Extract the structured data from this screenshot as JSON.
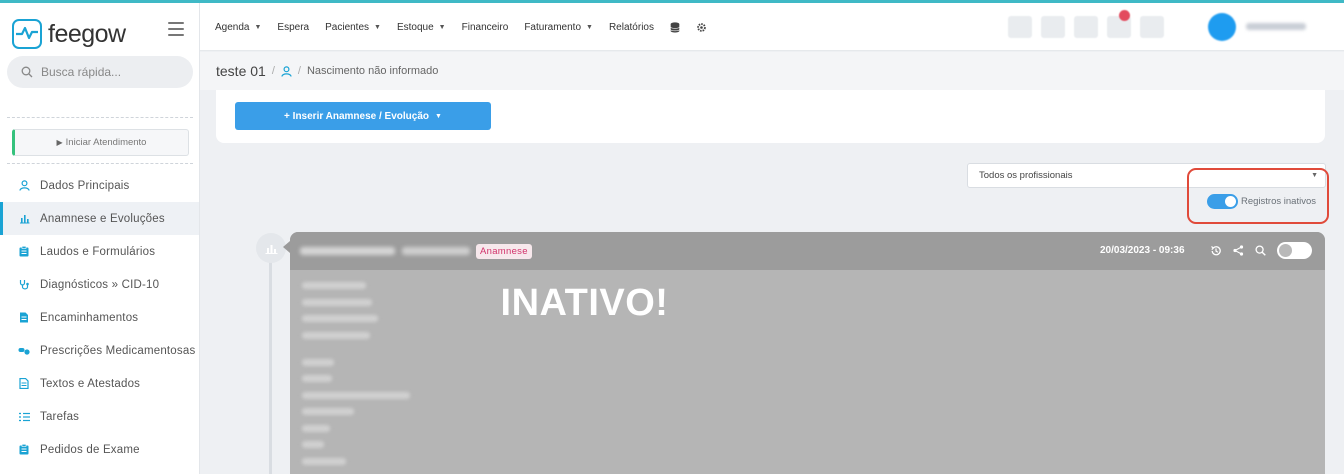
{
  "app": {
    "brand": "feegow"
  },
  "sidebar": {
    "search_placeholder": "Busca rápida...",
    "start_button": "Iniciar Atendimento",
    "items": [
      {
        "label": "Dados Principais",
        "icon": "user-icon"
      },
      {
        "label": "Anamnese e Evoluções",
        "icon": "chart-icon",
        "active": true
      },
      {
        "label": "Laudos e Formulários",
        "icon": "clipboard-icon"
      },
      {
        "label": "Diagnósticos » CID-10",
        "icon": "stethoscope-icon"
      },
      {
        "label": "Encaminhamentos",
        "icon": "document-icon"
      },
      {
        "label": "Prescrições Medicamentosas",
        "icon": "pills-icon"
      },
      {
        "label": "Textos e Atestados",
        "icon": "text-document-icon"
      },
      {
        "label": "Tarefas",
        "icon": "checklist-icon"
      },
      {
        "label": "Pedidos de Exame",
        "icon": "clipboard-icon"
      }
    ]
  },
  "topnav": {
    "items": [
      {
        "label": "Agenda",
        "dropdown": true
      },
      {
        "label": "Espera",
        "dropdown": false
      },
      {
        "label": "Pacientes",
        "dropdown": true
      },
      {
        "label": "Estoque",
        "dropdown": true
      },
      {
        "label": "Financeiro",
        "dropdown": false
      },
      {
        "label": "Faturamento",
        "dropdown": true
      },
      {
        "label": "Relatórios",
        "dropdown": false
      }
    ]
  },
  "breadcrumb": {
    "patient": "teste 01",
    "separator": "/",
    "birth": "Nascimento não informado"
  },
  "main": {
    "insert_button": "+ Inserir Anamnese / Evolução",
    "professional_filter": "Todos os profissionais",
    "inactive_toggle_label": "Registros inativos",
    "inactive_toggle_on": true
  },
  "record": {
    "tag": "Anamnese",
    "datetime": "20/03/2023 - 09:36",
    "overlay": "INATIVO!"
  },
  "colors": {
    "brand": "#1aa3d4",
    "primary_button": "#3a9ee8",
    "highlight": "#e04a3a",
    "tag_text": "#d2336b",
    "record_background": "#b5b5b5"
  }
}
